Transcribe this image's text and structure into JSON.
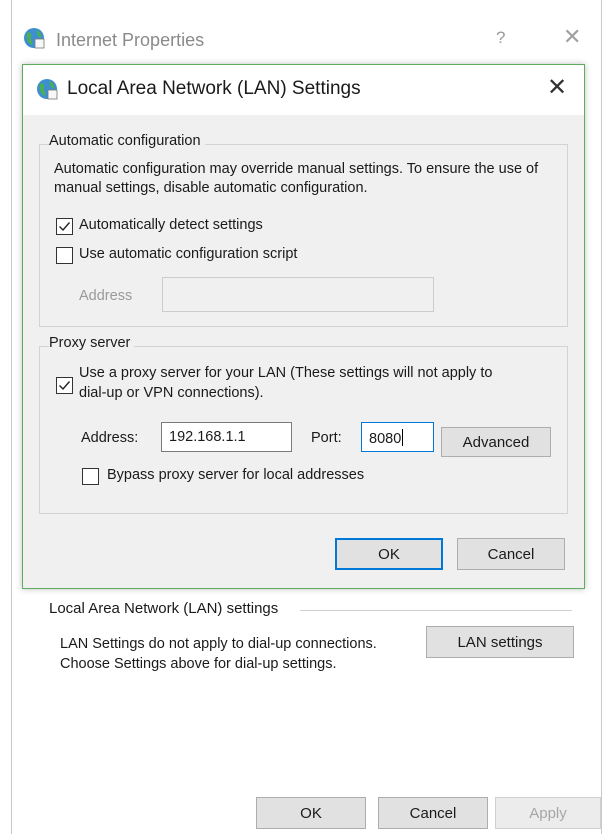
{
  "outer": {
    "title": "Internet Properties",
    "help_glyph": "?",
    "close_glyph": "✕",
    "lan_group_label": "Local Area Network (LAN) settings",
    "lan_description": "LAN Settings do not apply to dial-up connections. Choose Settings above for dial-up settings.",
    "lan_settings_button": "LAN settings",
    "ok_button": "OK",
    "cancel_button": "Cancel",
    "apply_button": "Apply"
  },
  "dialog": {
    "title": "Local Area Network (LAN) Settings",
    "close_glyph": "✕",
    "auto_config": {
      "group_label": "Automatic configuration",
      "description": "Automatic configuration may override manual settings.  To ensure the use of manual settings, disable automatic configuration.",
      "auto_detect_label": "Automatically detect settings",
      "auto_detect_checked": true,
      "use_script_label": "Use automatic configuration script",
      "use_script_checked": false,
      "address_label": "Address",
      "address_value": ""
    },
    "proxy": {
      "group_label": "Proxy server",
      "use_proxy_label_line1": "Use a proxy server for your LAN (These settings will not apply to",
      "use_proxy_label_line2": "dial-up or VPN connections).",
      "use_proxy_checked": true,
      "address_label": "Address:",
      "address_value": "192.168.1.1",
      "port_label": "Port:",
      "port_value": "8080",
      "advanced_button": "Advanced",
      "bypass_label": "Bypass proxy server for local addresses",
      "bypass_checked": false
    },
    "ok_button": "OK",
    "cancel_button": "Cancel"
  },
  "colors": {
    "dialog_border": "#5eac5e",
    "focus_blue": "#0078d7",
    "button_face": "#e1e1e1"
  },
  "icons": [
    "globe-icon",
    "help-icon",
    "close-icon",
    "checkmark-icon"
  ]
}
